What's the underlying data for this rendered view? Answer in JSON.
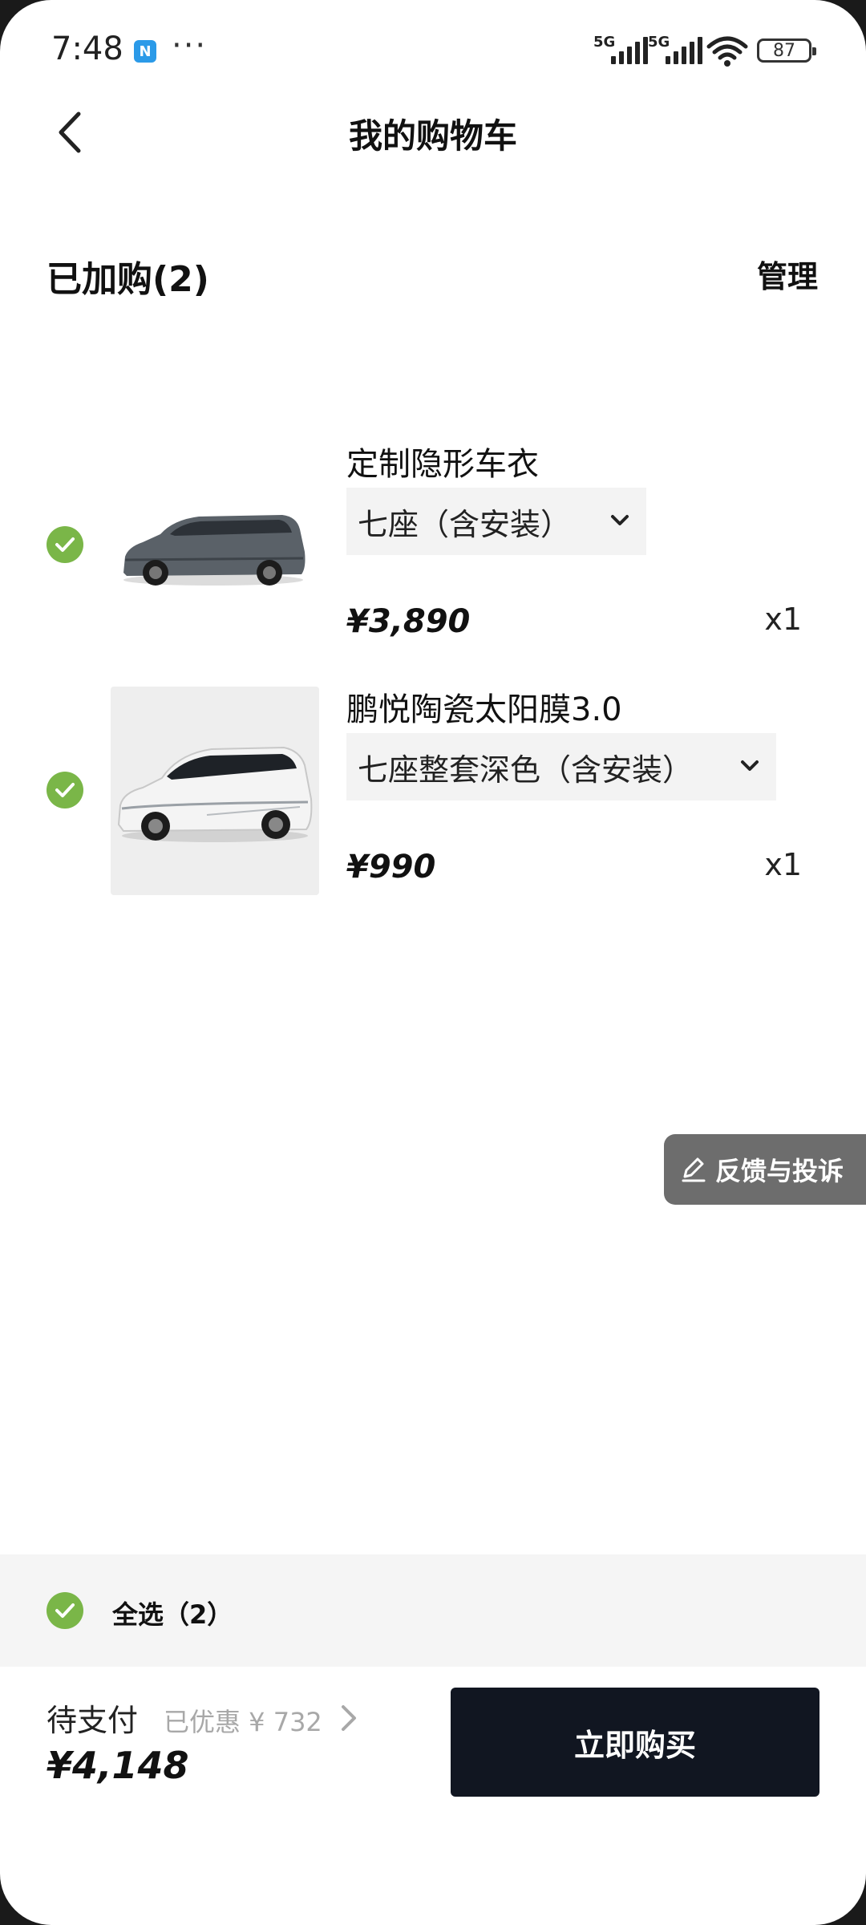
{
  "status_bar": {
    "time": "7:48",
    "nfc_icon": "N",
    "more": "···",
    "signal1_label": "5G",
    "signal2_label": "5G",
    "battery": "87"
  },
  "header": {
    "title": "我的购物车"
  },
  "cart": {
    "added_label": "已加购(2)",
    "manage_label": "管理",
    "items": [
      {
        "name": "定制隐形车衣",
        "spec": "七座（含安装）",
        "price": "¥3,890",
        "qty": "x1",
        "image_icon": "dark-gray-mpv-car"
      },
      {
        "name": "鹏悦陶瓷太阳膜3.0",
        "spec": "七座整套深色（含安装）",
        "price": "¥990",
        "qty": "x1",
        "image_icon": "white-mpv-car"
      }
    ]
  },
  "feedback": {
    "label": "反馈与投诉"
  },
  "footer": {
    "select_all_label": "全选（2）",
    "pay_label": "待支付",
    "discount_text": "已优惠 ¥ 732",
    "total": "¥4,148",
    "buy_label": "立即购买"
  },
  "colors": {
    "check_green": "#7ab648",
    "buy_button": "#111621",
    "feedback_bg": "#6d6d6d"
  }
}
